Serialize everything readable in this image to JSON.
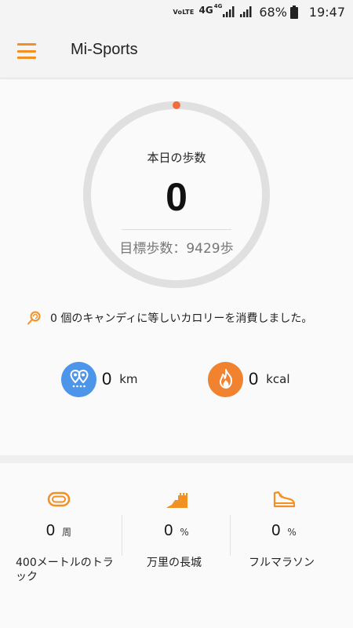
{
  "status_bar": {
    "volte": "VoLTE",
    "network_1": "4G",
    "network_2": "4G",
    "battery": "68%",
    "time": "19:47"
  },
  "app_bar": {
    "title": "Mi-Sports",
    "menu_icon": "hamburger-menu-icon"
  },
  "accent_color": "#f39023",
  "steps": {
    "label": "本日の歩数",
    "value": "0",
    "goal": "目標歩数：9429歩",
    "progress_fraction": 0
  },
  "candy": {
    "icon": "lollipop-icon",
    "text": "0 個のキャンディに等しいカロリーを消費しました。"
  },
  "stats": {
    "distance": {
      "value": "0",
      "unit": "km",
      "icon": "map-pin-icon"
    },
    "calories": {
      "value": "0",
      "unit": "kcal",
      "icon": "flame-icon"
    }
  },
  "challenges": [
    {
      "icon": "track-icon",
      "value": "0",
      "unit": "周",
      "name": "400メートルのトラック"
    },
    {
      "icon": "great-wall-icon",
      "value": "0",
      "unit": "%",
      "name": "万里の長城"
    },
    {
      "icon": "running-shoe-icon",
      "value": "0",
      "unit": "%",
      "name": "フルマラソン"
    }
  ]
}
